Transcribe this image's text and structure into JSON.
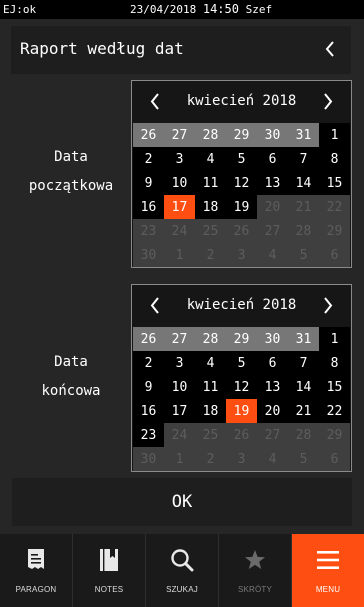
{
  "status": {
    "left": "EJ:ok",
    "date": "23/04/2018",
    "time": "14:50",
    "user": "Szef"
  },
  "header": {
    "title": "Raport według dat"
  },
  "start": {
    "label_line1": "Data",
    "label_line2": "początkowa",
    "month": "kwiecień 2018",
    "rows": [
      [
        "26",
        "27",
        "28",
        "29",
        "30",
        "31",
        "1"
      ],
      [
        "2",
        "3",
        "4",
        "5",
        "6",
        "7",
        "8"
      ],
      [
        "9",
        "10",
        "11",
        "12",
        "13",
        "14",
        "15"
      ],
      [
        "16",
        "17",
        "18",
        "19",
        "20",
        "21",
        "22"
      ],
      [
        "23",
        "24",
        "25",
        "26",
        "27",
        "28",
        "29"
      ],
      [
        "30",
        "1",
        "2",
        "3",
        "4",
        "5",
        "6"
      ]
    ],
    "prev_month_count": 6,
    "last_enabled_index": 24,
    "selected_index": 22
  },
  "end": {
    "label_line1": "Data",
    "label_line2": "końcowa",
    "month": "kwiecień 2018",
    "rows": [
      [
        "26",
        "27",
        "28",
        "29",
        "30",
        "31",
        "1"
      ],
      [
        "2",
        "3",
        "4",
        "5",
        "6",
        "7",
        "8"
      ],
      [
        "9",
        "10",
        "11",
        "12",
        "13",
        "14",
        "15"
      ],
      [
        "16",
        "17",
        "18",
        "19",
        "20",
        "21",
        "22"
      ],
      [
        "23",
        "24",
        "25",
        "26",
        "27",
        "28",
        "29"
      ],
      [
        "30",
        "1",
        "2",
        "3",
        "4",
        "5",
        "6"
      ]
    ],
    "prev_month_count": 6,
    "last_enabled_index": 28,
    "selected_index": 24
  },
  "ok_label": "OK",
  "tabs": [
    {
      "label": "PARAGON",
      "icon": "receipt-icon",
      "state": "normal"
    },
    {
      "label": "NOTES",
      "icon": "notebook-icon",
      "state": "normal"
    },
    {
      "label": "SZUKAJ",
      "icon": "search-icon",
      "state": "normal"
    },
    {
      "label": "SKRÓTY",
      "icon": "star-icon",
      "state": "disabled"
    },
    {
      "label": "MENU",
      "icon": "hamburger-menu-icon",
      "state": "active"
    }
  ],
  "colors": {
    "accent": "#ff4e11",
    "background": "#262626",
    "panel": "#1e1e1e"
  }
}
